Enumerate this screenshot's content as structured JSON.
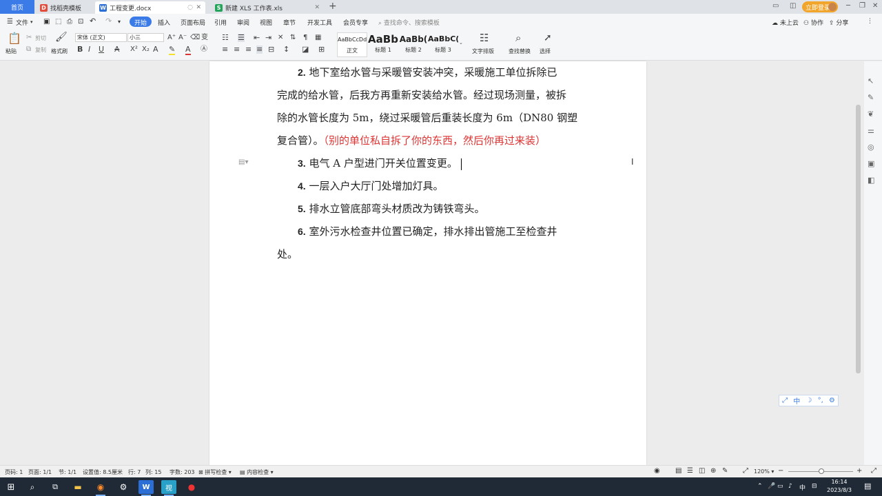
{
  "tabs": [
    {
      "label": "首页"
    },
    {
      "label": "找稻壳模板"
    },
    {
      "label": "工程变更.docx"
    },
    {
      "label": "新建 XLS 工作表.xls"
    }
  ],
  "header": {
    "login_label": "立即登录"
  },
  "menu": {
    "file": "文件",
    "items": [
      "开始",
      "插入",
      "页面布局",
      "引用",
      "审阅",
      "视图",
      "章节",
      "开发工具",
      "会员专享"
    ],
    "search_placeholder": "查找命令、搜索模板",
    "cloud": "未上云",
    "collab": "协作",
    "share": "分享"
  },
  "ribbon": {
    "paste": "粘贴",
    "cut": "剪切",
    "copy": "复制",
    "format_painter": "格式刷",
    "font_name": "宋体 (正文)",
    "font_size": "小三",
    "styles": [
      {
        "preview": "AaBbCcDd",
        "label": "正文"
      },
      {
        "preview": "AaBb",
        "label": "标题 1"
      },
      {
        "preview": "AaBb(",
        "label": "标题 2"
      },
      {
        "preview": "AaBbC(",
        "label": "标题 3"
      }
    ],
    "text_layout": "文字排版",
    "find_replace": "查找替换",
    "select": "选择"
  },
  "document": {
    "paragraphs": [
      {
        "num": "2.",
        "lines": [
          "地下室给水管与采暖管安装冲突，采暖施工单位拆除已",
          "完成的给水管，后我方再重新安装给水管。经过现场测量，被拆",
          "除的水管长度为 5m，绕过采暖管后重装长度为 6m（DN80 钢塑",
          "复合管）。"
        ],
        "note": "（别的单位私自拆了你的东西，然后你再过来装）"
      },
      {
        "num": "3.",
        "text": "电气 A 户型进门开关位置变更。"
      },
      {
        "num": "4.",
        "text": "一层入户大厅门处增加灯具。"
      },
      {
        "num": "5.",
        "text": "排水立管底部弯头材质改为铸铁弯头。"
      },
      {
        "num": "6.",
        "lines": [
          "室外污水检查井位置已确定，排水排出管施工至检查井",
          "处。"
        ]
      }
    ]
  },
  "ime": {
    "mode": "中"
  },
  "status": {
    "page_no": "页码: 1",
    "pages": "页面: 1/1",
    "section": "节: 1/1",
    "setting": "设置值: 8.5厘米",
    "row": "行: 7",
    "col": "列: 15",
    "words": "字数: 203",
    "spell": "拼写检查",
    "content_check": "内容检查",
    "zoom": "120%"
  },
  "taskbar": {
    "clock_time": "16:14",
    "clock_date": "2023/8/3",
    "ime": "中"
  },
  "colors": {
    "accent": "#3b7be8",
    "annotation_red": "#d33333",
    "login": "#f2a52b"
  }
}
